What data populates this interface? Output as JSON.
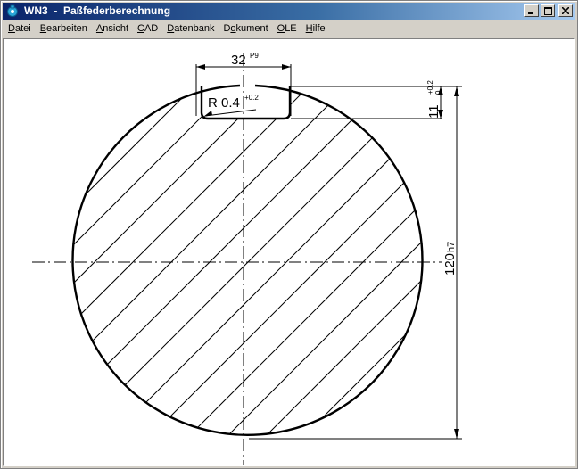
{
  "window": {
    "title": "WN3  -  Paßfederberechnung"
  },
  "menu": {
    "items": [
      {
        "label": "Datei",
        "accel": "D"
      },
      {
        "label": "Bearbeiten",
        "accel": "B"
      },
      {
        "label": "Ansicht",
        "accel": "A"
      },
      {
        "label": "CAD",
        "accel": "C"
      },
      {
        "label": "Datenbank",
        "accel": "D"
      },
      {
        "label": "Dokument",
        "accel": "o"
      },
      {
        "label": "OLE",
        "accel": "O"
      },
      {
        "label": "Hilfe",
        "accel": "H"
      }
    ]
  },
  "drawing": {
    "key_width": "32",
    "key_width_tolerance": "P9",
    "radius_label": "R 0.4",
    "radius_tolerance": "+0.2",
    "depth": "11",
    "depth_tol_upper": "+0.2",
    "depth_tol_lower": "0",
    "diameter": "120",
    "diameter_tolerance": "h7"
  },
  "colors": {
    "title_start": "#0a246a",
    "title_end": "#a6caf0",
    "drawing_line": "#000000",
    "canvas": "#ffffff"
  }
}
